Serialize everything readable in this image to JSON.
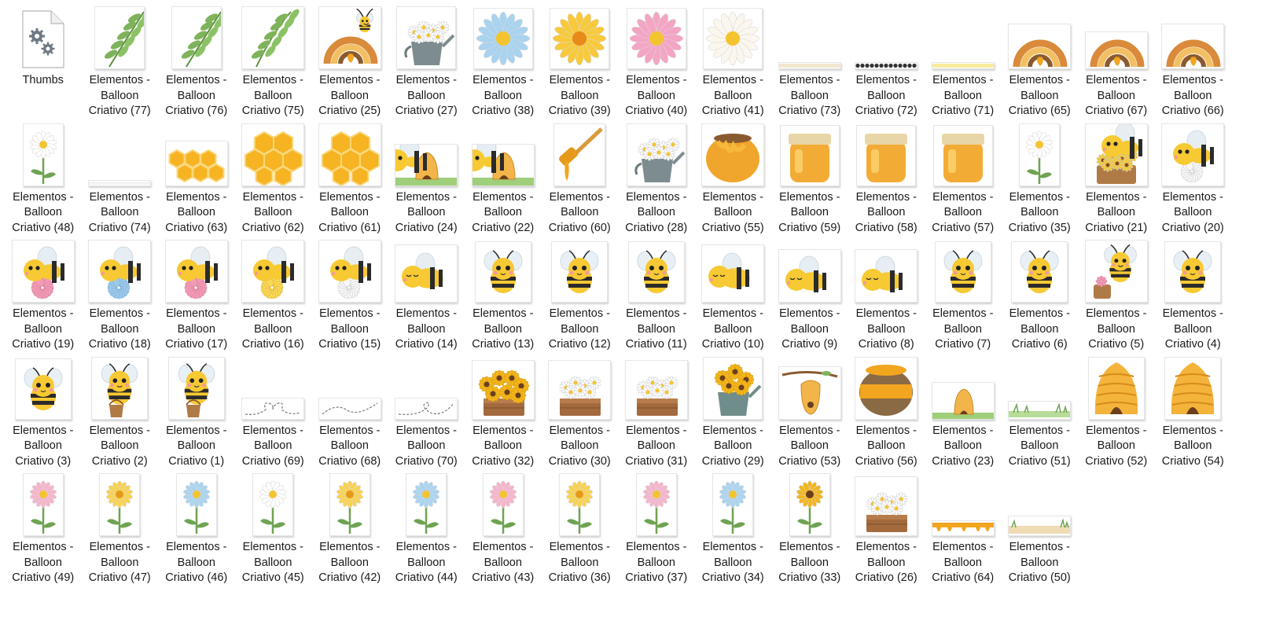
{
  "folder_items": [
    {
      "label": "Thumbs",
      "kind": "file"
    },
    {
      "label": "Elementos -\nBalloon\nCriativo (77)",
      "kind": "leaf"
    },
    {
      "label": "Elementos -\nBalloon\nCriativo (76)",
      "kind": "leaf"
    },
    {
      "label": "Elementos -\nBalloon\nCriativo (75)",
      "kind": "leaf-branch"
    },
    {
      "label": "Elementos -\nBalloon\nCriativo (25)",
      "kind": "rainbow-bee"
    },
    {
      "label": "Elementos -\nBalloon\nCriativo (27)",
      "kind": "watering-can"
    },
    {
      "label": "Elementos -\nBalloon\nCriativo (38)",
      "kind": "daisy-blue"
    },
    {
      "label": "Elementos -\nBalloon\nCriativo (39)",
      "kind": "daisy-yellow"
    },
    {
      "label": "Elementos -\nBalloon\nCriativo (40)",
      "kind": "daisy-pink"
    },
    {
      "label": "Elementos -\nBalloon\nCriativo (41)",
      "kind": "daisy-white"
    },
    {
      "label": "Elementos -\nBalloon\nCriativo (73)",
      "kind": "strip-cream"
    },
    {
      "label": "Elementos -\nBalloon\nCriativo (72)",
      "kind": "strip-dots"
    },
    {
      "label": "Elementos -\nBalloon\nCriativo (71)",
      "kind": "strip-yellow"
    },
    {
      "label": "Elementos -\nBalloon\nCriativo (65)",
      "kind": "rainbow"
    },
    {
      "label": "Elementos -\nBalloon\nCriativo (67)",
      "kind": "rainbow-small"
    },
    {
      "label": "Elementos -\nBalloon\nCriativo (66)",
      "kind": "rainbow"
    },
    {
      "label": "Elementos -\nBalloon\nCriativo (48)",
      "kind": "flower-white"
    },
    {
      "label": "Elementos -\nBalloon\nCriativo (74)",
      "kind": "strip-blank"
    },
    {
      "label": "Elementos -\nBalloon\nCriativo (63)",
      "kind": "honeycomb-row"
    },
    {
      "label": "Elementos -\nBalloon\nCriativo (62)",
      "kind": "honeycomb"
    },
    {
      "label": "Elementos -\nBalloon\nCriativo (61)",
      "kind": "honeycomb"
    },
    {
      "label": "Elementos -\nBalloon\nCriativo (24)",
      "kind": "beehive-scene"
    },
    {
      "label": "Elementos -\nBalloon\nCriativo (22)",
      "kind": "beehive-scene"
    },
    {
      "label": "Elementos -\nBalloon\nCriativo (60)",
      "kind": "honey-dipper"
    },
    {
      "label": "Elementos -\nBalloon\nCriativo (28)",
      "kind": "watering-can"
    },
    {
      "label": "Elementos -\nBalloon\nCriativo (55)",
      "kind": "honey-pot"
    },
    {
      "label": "Elementos -\nBalloon\nCriativo (59)",
      "kind": "honey-jar"
    },
    {
      "label": "Elementos -\nBalloon\nCriativo (58)",
      "kind": "honey-jar"
    },
    {
      "label": "Elementos -\nBalloon\nCriativo (57)",
      "kind": "honey-jar"
    },
    {
      "label": "Elementos -\nBalloon\nCriativo (35)",
      "kind": "flower-white"
    },
    {
      "label": "Elementos -\nBalloon\nCriativo (21)",
      "kind": "bee-basket"
    },
    {
      "label": "Elementos -\nBalloon\nCriativo (20)",
      "kind": "bee-flower-white"
    },
    {
      "label": "Elementos -\nBalloon\nCriativo (19)",
      "kind": "bee-flower-pink"
    },
    {
      "label": "Elementos -\nBalloon\nCriativo (18)",
      "kind": "bee-flower-blue"
    },
    {
      "label": "Elementos -\nBalloon\nCriativo (17)",
      "kind": "bee-flower-pink"
    },
    {
      "label": "Elementos -\nBalloon\nCriativo (16)",
      "kind": "bee-flower-yellow"
    },
    {
      "label": "Elementos -\nBalloon\nCriativo (15)",
      "kind": "bee-flower-white"
    },
    {
      "label": "Elementos -\nBalloon\nCriativo (14)",
      "kind": "bee-sleep"
    },
    {
      "label": "Elementos -\nBalloon\nCriativo (13)",
      "kind": "bee"
    },
    {
      "label": "Elementos -\nBalloon\nCriativo (12)",
      "kind": "bee"
    },
    {
      "label": "Elementos -\nBalloon\nCriativo (11)",
      "kind": "bee"
    },
    {
      "label": "Elementos -\nBalloon\nCriativo (10)",
      "kind": "bee-sleep"
    },
    {
      "label": "Elementos -\nBalloon\nCriativo (9)",
      "kind": "bee-sleep-small"
    },
    {
      "label": "Elementos -\nBalloon\nCriativo (8)",
      "kind": "bee-sleep-small"
    },
    {
      "label": "Elementos -\nBalloon\nCriativo (7)",
      "kind": "bee"
    },
    {
      "label": "Elementos -\nBalloon\nCriativo (6)",
      "kind": "bee"
    },
    {
      "label": "Elementos -\nBalloon\nCriativo (5)",
      "kind": "bee-bouquet"
    },
    {
      "label": "Elementos -\nBalloon\nCriativo (4)",
      "kind": "bee"
    },
    {
      "label": "Elementos -\nBalloon\nCriativo (3)",
      "kind": "bee"
    },
    {
      "label": "Elementos -\nBalloon\nCriativo (2)",
      "kind": "bee-bucket"
    },
    {
      "label": "Elementos -\nBalloon\nCriativo (1)",
      "kind": "bee-bucket"
    },
    {
      "label": "Elementos -\nBalloon\nCriativo (69)",
      "kind": "dashed-heart"
    },
    {
      "label": "Elementos -\nBalloon\nCriativo (68)",
      "kind": "dashed-wave"
    },
    {
      "label": "Elementos -\nBalloon\nCriativo (70)",
      "kind": "dashed-loop"
    },
    {
      "label": "Elementos -\nBalloon\nCriativo (32)",
      "kind": "crate-sunflowers"
    },
    {
      "label": "Elementos -\nBalloon\nCriativo (30)",
      "kind": "crate-daisies"
    },
    {
      "label": "Elementos -\nBalloon\nCriativo (31)",
      "kind": "crate-daisies"
    },
    {
      "label": "Elementos -\nBalloon\nCriativo (29)",
      "kind": "can-sunflowers"
    },
    {
      "label": "Elementos -\nBalloon\nCriativo (53)",
      "kind": "hanging-hive"
    },
    {
      "label": "Elementos -\nBalloon\nCriativo (56)",
      "kind": "honey-pot-big"
    },
    {
      "label": "Elementos -\nBalloon\nCriativo (23)",
      "kind": "beehive-scene-small"
    },
    {
      "label": "Elementos -\nBalloon\nCriativo (51)",
      "kind": "grass-strip"
    },
    {
      "label": "Elementos -\nBalloon\nCriativo (52)",
      "kind": "skep"
    },
    {
      "label": "Elementos -\nBalloon\nCriativo (54)",
      "kind": "skep"
    },
    {
      "label": "Elementos -\nBalloon\nCriativo (49)",
      "kind": "flower-pink"
    },
    {
      "label": "Elementos -\nBalloon\nCriativo (47)",
      "kind": "flower-yellow"
    },
    {
      "label": "Elementos -\nBalloon\nCriativo (46)",
      "kind": "flower-blue"
    },
    {
      "label": "Elementos -\nBalloon\nCriativo (45)",
      "kind": "flower-white"
    },
    {
      "label": "Elementos -\nBalloon\nCriativo (42)",
      "kind": "flower-yellow"
    },
    {
      "label": "Elementos -\nBalloon\nCriativo (44)",
      "kind": "flower-blue"
    },
    {
      "label": "Elementos -\nBalloon\nCriativo (43)",
      "kind": "flower-pink"
    },
    {
      "label": "Elementos -\nBalloon\nCriativo (36)",
      "kind": "flower-yellow"
    },
    {
      "label": "Elementos -\nBalloon\nCriativo (37)",
      "kind": "flower-pink"
    },
    {
      "label": "Elementos -\nBalloon\nCriativo (34)",
      "kind": "flower-blue"
    },
    {
      "label": "Elementos -\nBalloon\nCriativo (33)",
      "kind": "sunflower"
    },
    {
      "label": "Elementos -\nBalloon\nCriativo (26)",
      "kind": "crate-daisies"
    },
    {
      "label": "Elementos -\nBalloon\nCriativo (64)",
      "kind": "honey-drip"
    },
    {
      "label": "Elementos -\nBalloon\nCriativo (50)",
      "kind": "ground-strip"
    }
  ],
  "colors": {
    "label_text": "#1a1a1a",
    "honey": "#f2a51e",
    "bee_yellow": "#f7c933",
    "bee_black": "#2b2b2b",
    "leaf_green": "#6ea351"
  }
}
